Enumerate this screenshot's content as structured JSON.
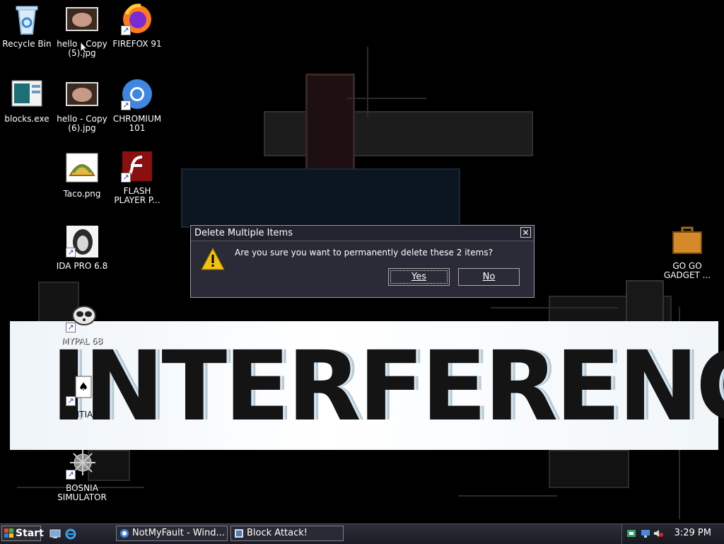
{
  "desktop_icons": {
    "recycle_bin": "Recycle Bin",
    "hello_copy5": "hello - Copy (5).jpg",
    "firefox": "FIREFOX 91",
    "blocks": "blocks.exe",
    "hello_copy6": "hello - Copy (6).jpg",
    "chromium": "CHROMIUM 101",
    "taco": "Taco.png",
    "flash": "FLASH PLAYER P...",
    "ida": "IDA PRO 6.8",
    "mypal": "MYPAL 68",
    "solitaire": "SOLITIARE",
    "bosnia": "BOSNIA SIMULATOR",
    "gogo": "GO GO GADGET ..."
  },
  "banner": {
    "text": "INTERFERENCE"
  },
  "dialog": {
    "title": "Delete Multiple Items",
    "close": "✕",
    "message": "Are you sure you want to permanently delete these 2 items?",
    "yes": "Yes",
    "no": "No"
  },
  "taskbar": {
    "start": "Start",
    "tasks": [
      "NotMyFault - Wind...",
      "Block Attack!"
    ],
    "clock": "3:29 PM"
  },
  "colors": {
    "desktop_bg": "#000000",
    "dialog_bg": "#2b2b38",
    "taskbar_bg": "#1b1b24"
  }
}
